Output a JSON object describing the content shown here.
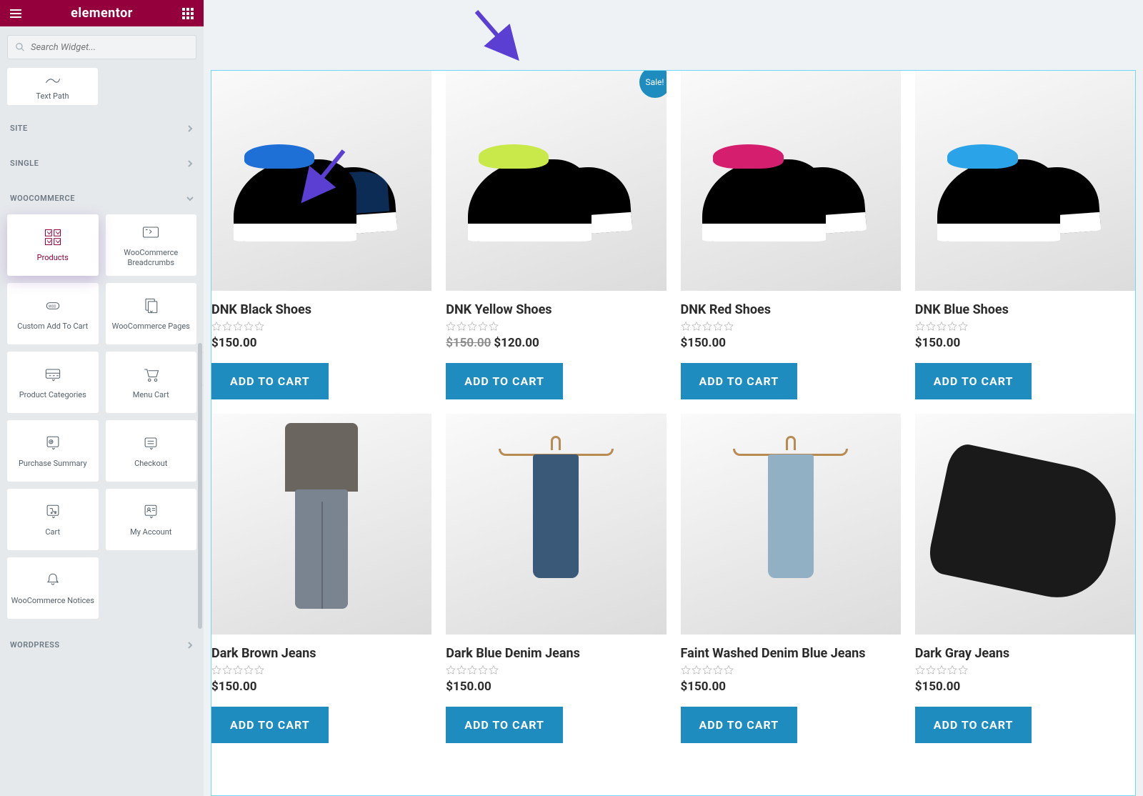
{
  "header": {
    "logo": "elementor"
  },
  "search": {
    "placeholder": "Search Widget..."
  },
  "topWidget": {
    "label": "Text Path"
  },
  "sections": {
    "site": "SITE",
    "single": "SINGLE",
    "woocommerce": "WOOCOMMERCE",
    "wordpress": "WORDPRESS"
  },
  "wcWidgets": [
    {
      "key": "products",
      "label": "Products",
      "active": true
    },
    {
      "key": "breadcrumbs",
      "label": "WooCommerce Breadcrumbs"
    },
    {
      "key": "custom-add",
      "label": "Custom Add To Cart"
    },
    {
      "key": "wc-pages",
      "label": "WooCommerce Pages"
    },
    {
      "key": "product-categories",
      "label": "Product Categories"
    },
    {
      "key": "menu-cart",
      "label": "Menu Cart"
    },
    {
      "key": "purchase-summary",
      "label": "Purchase Summary"
    },
    {
      "key": "checkout",
      "label": "Checkout"
    },
    {
      "key": "cart",
      "label": "Cart"
    },
    {
      "key": "my-account",
      "label": "My Account"
    },
    {
      "key": "wc-notices",
      "label": "WooCommerce Notices"
    }
  ],
  "saleBadge": "Sale!",
  "products": [
    {
      "title": "DNK Black Shoes",
      "price": "$150.00",
      "btn": "ADD TO CART",
      "img": "shoe-blue"
    },
    {
      "title": "DNK Yellow Shoes",
      "oldPrice": "$150.00",
      "price": "$120.00",
      "sale": true,
      "btn": "ADD TO CART",
      "img": "shoe-yellow"
    },
    {
      "title": "DNK Red Shoes",
      "price": "$150.00",
      "btn": "ADD TO CART",
      "img": "shoe-red"
    },
    {
      "title": "DNK Blue Shoes",
      "price": "$150.00",
      "btn": "ADD TO CART",
      "img": "shoe-blue2"
    },
    {
      "title": "Dark Brown Jeans",
      "price": "$150.00",
      "btn": "ADD TO CART",
      "img": "person"
    },
    {
      "title": "Dark Blue Denim Jeans",
      "price": "$150.00",
      "btn": "ADD TO CART",
      "img": "hanger-blue"
    },
    {
      "title": "Faint Washed Denim Blue Jeans",
      "price": "$150.00",
      "btn": "ADD TO CART",
      "img": "hanger-light"
    },
    {
      "title": "Dark Gray Jeans",
      "price": "$150.00",
      "btn": "ADD TO CART",
      "img": "darkpants"
    }
  ]
}
